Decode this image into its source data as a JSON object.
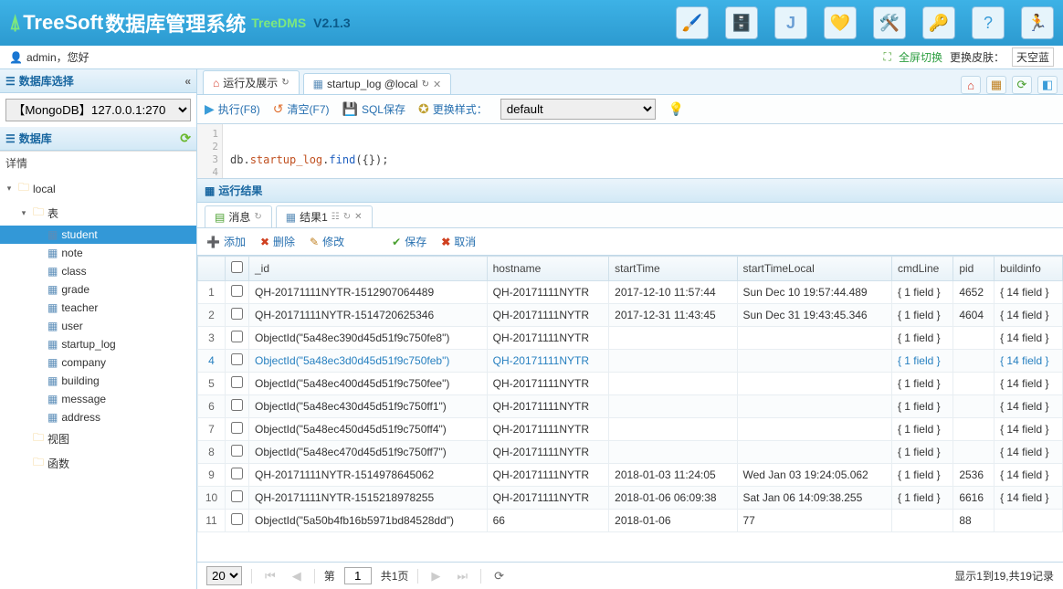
{
  "header": {
    "brand": "TreeSoft",
    "title": "数据库管理系统",
    "subtitle": "TreeDMS",
    "version": "V2.1.3"
  },
  "subheader": {
    "user": "admin",
    "greeting": "，您好",
    "fullscreen": "全屏切换",
    "skin_label": "更换皮肤：",
    "skin_value": "天空蓝"
  },
  "sidebar": {
    "select_title": "数据库选择",
    "db_option": "【MongoDB】127.0.0.1:270",
    "db_title": "数据库",
    "detail": "详情",
    "tree": {
      "root": "local",
      "tables_label": "表",
      "tables": [
        "student",
        "note",
        "class",
        "grade",
        "teacher",
        "user",
        "startup_log",
        "company",
        "building",
        "message",
        "address"
      ],
      "views": "视图",
      "functions": "函数"
    }
  },
  "tabs": {
    "run": "运行及展示",
    "table": "startup_log @local"
  },
  "toolbar": {
    "execute": "执行(F8)",
    "clear": "清空(F7)",
    "sql_save": "SQL保存",
    "style_label": "更换样式：",
    "style_value": "default"
  },
  "editor": {
    "code": "db.startup_log.find({});"
  },
  "result": {
    "title": "运行结果",
    "tab_msg": "消息",
    "tab_result": "结果1"
  },
  "actions": {
    "add": "添加",
    "delete": "删除",
    "edit": "修改",
    "save": "保存",
    "cancel": "取消"
  },
  "grid": {
    "columns": [
      "_id",
      "hostname",
      "startTime",
      "startTimeLocal",
      "cmdLine",
      "pid",
      "buildinfo"
    ],
    "rows": [
      [
        "QH-20171111NYTR-1512907064489",
        "QH-20171111NYTR",
        "2017-12-10 11:57:44",
        "Sun Dec 10 19:57:44.489",
        "{ 1 field }",
        "4652",
        "{ 14 field }"
      ],
      [
        "QH-20171111NYTR-1514720625346",
        "QH-20171111NYTR",
        "2017-12-31 11:43:45",
        "Sun Dec 31 19:43:45.346",
        "{ 1 field }",
        "4604",
        "{ 14 field }"
      ],
      [
        "ObjectId(\"5a48ec390d45d51f9c750fe8\")",
        "QH-20171111NYTR",
        "",
        "",
        "{ 1 field }",
        "",
        "{ 14 field }"
      ],
      [
        "ObjectId(\"5a48ec3d0d45d51f9c750feb\")",
        "QH-20171111NYTR",
        "",
        "",
        "{ 1 field }",
        "",
        "{ 14 field }"
      ],
      [
        "ObjectId(\"5a48ec400d45d51f9c750fee\")",
        "QH-20171111NYTR",
        "",
        "",
        "{ 1 field }",
        "",
        "{ 14 field }"
      ],
      [
        "ObjectId(\"5a48ec430d45d51f9c750ff1\")",
        "QH-20171111NYTR",
        "",
        "",
        "{ 1 field }",
        "",
        "{ 14 field }"
      ],
      [
        "ObjectId(\"5a48ec450d45d51f9c750ff4\")",
        "QH-20171111NYTR",
        "",
        "",
        "{ 1 field }",
        "",
        "{ 14 field }"
      ],
      [
        "ObjectId(\"5a48ec470d45d51f9c750ff7\")",
        "QH-20171111NYTR",
        "",
        "",
        "{ 1 field }",
        "",
        "{ 14 field }"
      ],
      [
        "QH-20171111NYTR-1514978645062",
        "QH-20171111NYTR",
        "2018-01-03 11:24:05",
        "Wed Jan 03 19:24:05.062",
        "{ 1 field }",
        "2536",
        "{ 14 field }"
      ],
      [
        "QH-20171111NYTR-1515218978255",
        "QH-20171111NYTR",
        "2018-01-06 06:09:38",
        "Sat Jan 06 14:09:38.255",
        "{ 1 field }",
        "6616",
        "{ 14 field }"
      ],
      [
        "ObjectId(\"5a50b4fb16b5971bd84528dd\")",
        "66",
        "2018-01-06",
        "77",
        "",
        "88",
        ""
      ]
    ]
  },
  "pager": {
    "page_size": "20",
    "page_label_pre": "第",
    "page_num": "1",
    "page_label_post": "共1页",
    "summary": "显示1到19,共19记录"
  }
}
